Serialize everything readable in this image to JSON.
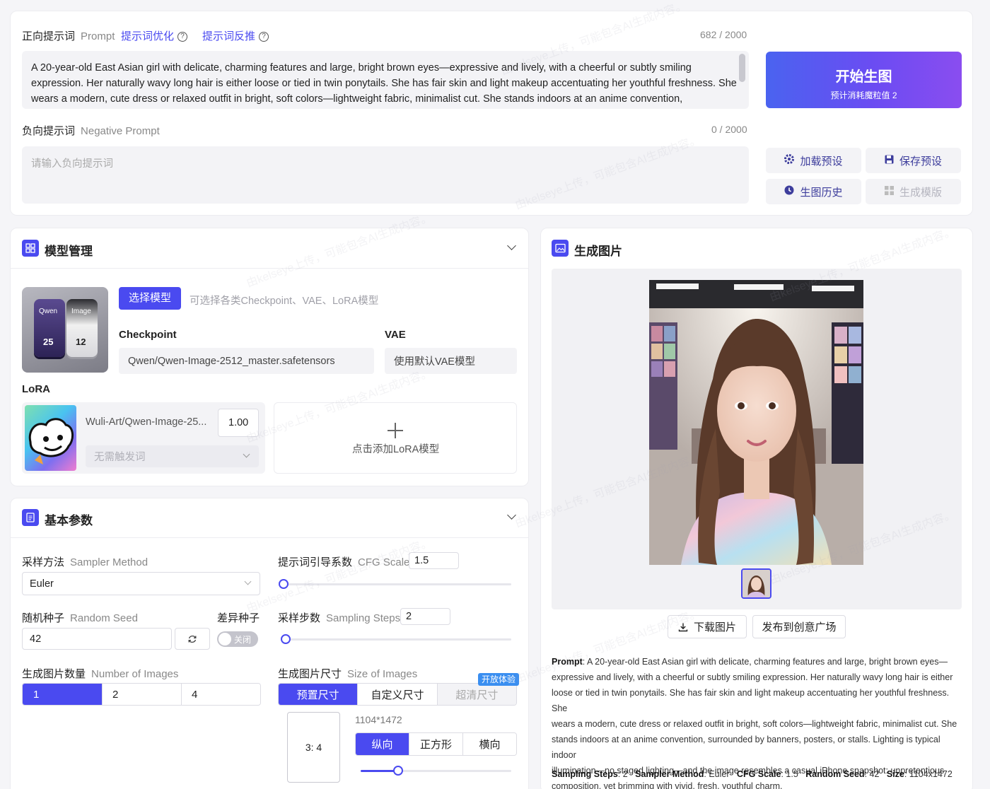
{
  "prompt": {
    "label": "正向提示词",
    "label_en": "Prompt",
    "optimize_link": "提示词优化",
    "reverse_link": "提示词反推",
    "count": "682 / 2000",
    "lines": [
      "A 20-year-old East Asian girl with delicate, charming features and large, bright brown eyes—expressive and lively, with a cheerful or subtly smiling",
      "expression. Her naturally wavy long hair is either loose or tied in twin ponytails. She has fair skin and light makeup accentuating her youthful freshness. She",
      "wears a modern, cute dress or relaxed outfit in bright, soft colors—lightweight fabric, minimalist cut. She stands indoors at an anime convention,"
    ]
  },
  "negative": {
    "label": "负向提示词",
    "label_en": "Negative Prompt",
    "count": "0 / 2000",
    "placeholder": "请输入负向提示词"
  },
  "generate": {
    "title": "开始生图",
    "subtitle": "预计消耗魔粒值 2"
  },
  "presets": {
    "load": "加载预设",
    "save": "保存预设",
    "history": "生图历史",
    "template": "生成模版"
  },
  "model": {
    "title": "模型管理",
    "thumb_labels": [
      "Qwen",
      "Image",
      "25",
      "12"
    ],
    "select_btn": "选择模型",
    "hint": "可选择各类Checkpoint、VAE、LoRA模型",
    "checkpoint_label": "Checkpoint",
    "checkpoint_value": "Qwen/Qwen-Image-2512_master.safetensors",
    "vae_label": "VAE",
    "vae_value": "使用默认VAE模型",
    "lora_label": "LoRA",
    "lora_name": "Wuli-Art/Qwen-Image-25...",
    "lora_weight": "1.00",
    "lora_trigger": "无需触发词",
    "add_lora": "点击添加LoRA模型"
  },
  "params": {
    "title": "基本参数",
    "sampler_label": "采样方法",
    "sampler_label_en": "Sampler Method",
    "sampler_value": "Euler",
    "cfg_label": "提示词引导系数",
    "cfg_label_en": "CFG Scale",
    "cfg_value": "1.5",
    "cfg_fraction": 0.0,
    "seed_label": "随机种子",
    "seed_label_en": "Random Seed",
    "seed_value": "42",
    "diff_seed_label": "差异种子",
    "toggle_text": "关闭",
    "steps_label": "采样步数",
    "steps_label_en": "Sampling Steps",
    "steps_value": "2",
    "steps_fraction": 0.0,
    "num_label": "生成图片数量",
    "num_label_en": "Number of Images",
    "num_options": [
      "1",
      "2",
      "4"
    ],
    "size_label": "生成图片尺寸",
    "size_label_en": "Size of Images",
    "size_tabs": [
      "预置尺寸",
      "自定义尺寸",
      "超清尺寸"
    ],
    "badge": "开放体验",
    "size_value": "1104*1472",
    "ratio": "3: 4",
    "orient": [
      "纵向",
      "正方形",
      "横向"
    ],
    "ratio_fraction": 0.25
  },
  "output": {
    "title": "生成图片",
    "download": "下载图片",
    "publish": "发布到创意广场",
    "prompt_label": "Prompt",
    "prompt_text": [
      "A 20-year-old East Asian girl with delicate, charming features and large, bright brown eyes—",
      "expressive and lively, with a cheerful or subtly smiling expression. Her naturally wavy long hair is either",
      "loose or tied in twin ponytails. She has fair skin and light makeup accentuating her youthful freshness. She",
      "wears a modern, cute dress or relaxed outfit in bright, soft colors—lightweight fabric, minimalist cut. She",
      "stands indoors at an anime convention, surrounded by banners, posters, or stalls. Lighting is typical indoor",
      "illumination—no staged lighting—and the image resembles a casual iPhone snapshot: unpretentious",
      "composition, yet brimming with vivid, fresh, youthful charm."
    ],
    "meta": {
      "steps_k": "Sampling Steps",
      "steps_v": "2",
      "sampler_k": "Sampler Method",
      "sampler_v": "Euler",
      "cfg_k": "CFG Scale",
      "cfg_v": "1.5",
      "seed_k": "Random Seed",
      "seed_v": "42",
      "size_k": "Size",
      "size_v": "1104x1472"
    }
  },
  "watermark": "由kelseye上传，可能包含AI生成内容。",
  "colors": {
    "accent": "#4a4af0",
    "bg": "#f5f5f8"
  }
}
